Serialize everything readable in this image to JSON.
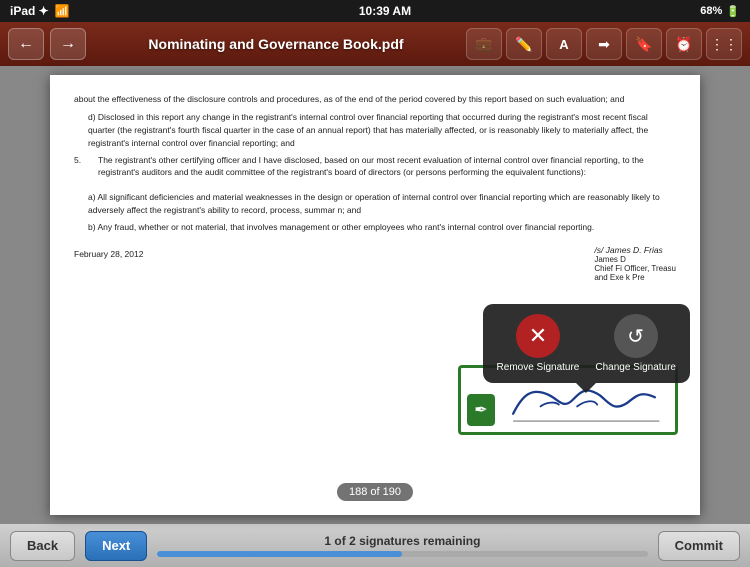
{
  "statusBar": {
    "left": "iPad ✦",
    "time": "10:39 AM",
    "right": "68%"
  },
  "toolbar": {
    "title": "Nominating and Governance Book.pdf",
    "backArrowLabel": "←",
    "forwardArrowLabel": "→",
    "icons": [
      "briefcase",
      "pen",
      "A",
      "arrow-right",
      "bookmark",
      "clock",
      "grid"
    ]
  },
  "document": {
    "paragraphD": "d) Disclosed in this report any change in the registrant's internal control over financial reporting that occurred during the registrant's most recent fiscal quarter (the registrant's fourth fiscal quarter in the case of an annual report) that has materially affected, or is reasonably likely to materially affect, the registrant's internal control over financial reporting; and",
    "item5": "5.",
    "item5text": "The registrant's other certifying officer and I have disclosed, based on our most recent evaluation of internal control over financial reporting, to the registrant's auditors and the audit committee of the registrant's board of directors (or persons performing the equivalent functions):",
    "paragraphA": "a) All significant deficiencies and material weaknesses in the design or operation of internal control over financial reporting which are reasonably likely to adversely affect the registrant's ability to record, process, summar                                                          n; and",
    "paragraphB": "b) Any fraud, whether or not material, that involves management or other employees who                                                       rant's internal control over financial reporting.",
    "date": "February 28, 2012",
    "sigName": "/s/ James D. Frias",
    "sigTitle1": "James D",
    "sigTitle2": "Chief Fi             Officer, Treasu",
    "sigTitle3": "and Exe              k Pre",
    "pageIndicator": "188 of 190"
  },
  "popup": {
    "removeLabel": "Remove Signature",
    "changeLabel": "Change Signature"
  },
  "bottomBar": {
    "backLabel": "Back",
    "nextLabel": "Next",
    "progressLabel": "1 of 2 signatures remaining",
    "progressPercent": 50,
    "commitLabel": "Commit"
  }
}
